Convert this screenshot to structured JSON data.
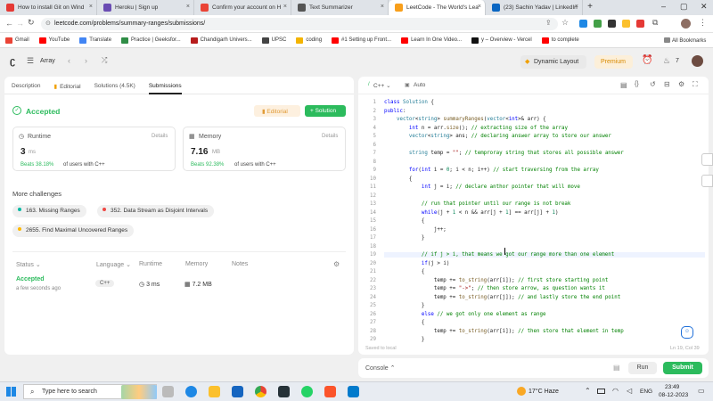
{
  "browser_tabs": [
    {
      "title": "How to install Git on Wind",
      "fav": "#e53935"
    },
    {
      "title": "Heroku | Sign up",
      "fav": "#6a4cb3"
    },
    {
      "title": "Confirm your account on H",
      "fav": "#ea4335"
    },
    {
      "title": "Text Summarizer",
      "fav": "#555555"
    },
    {
      "title": "LeetCode - The World's Lea",
      "fav": "#f89f1b"
    },
    {
      "title": "(23) Sachin Yadav | LinkedIn",
      "fav": "#0a66c2"
    }
  ],
  "address": {
    "url": "leetcode.com/problems/summary-ranges/submissions/"
  },
  "bookmarks": [
    {
      "label": "Gmail",
      "color": "#ea4335"
    },
    {
      "label": "YouTube",
      "color": "#ff0000"
    },
    {
      "label": "Translate",
      "color": "#4285f4"
    },
    {
      "label": "Practice | Geeksfor...",
      "color": "#2f8d46"
    },
    {
      "label": "Chandigarh Univers...",
      "color": "#b71c1c"
    },
    {
      "label": "UPSC",
      "color": "#444444"
    },
    {
      "label": "coding",
      "color": "#f4b400"
    },
    {
      "label": "#1 Setting up Front...",
      "color": "#ff0000"
    },
    {
      "label": "Learn In One Video...",
      "color": "#ff0000"
    },
    {
      "label": "y – Overview - Vercel",
      "color": "#111111"
    },
    {
      "label": "to complete",
      "color": "#ff0000"
    }
  ],
  "all_bookmarks": "All Bookmarks",
  "lc": {
    "problem_list": "Array",
    "layout": "Dynamic Layout",
    "premium": "Premium",
    "streak": "7"
  },
  "left_tabs": [
    "Description",
    "Editorial",
    "Solutions (4.5K)",
    "Submissions"
  ],
  "result": {
    "status": "Accepted",
    "editorial_btn": "Editorial",
    "solution_btn": "+ Solution",
    "runtime_label": "Runtime",
    "runtime_value": "3",
    "runtime_unit": "ms",
    "runtime_beats": "Beats 38.18%",
    "runtime_suffix": "of users with C++",
    "memory_label": "Memory",
    "memory_value": "7.16",
    "memory_unit": "MB",
    "memory_beats": "Beats 92.38%",
    "memory_suffix": "of users with C++",
    "details": "Details"
  },
  "more_challenges": {
    "heading": "More challenges",
    "items": [
      {
        "label": "163. Missing Ranges",
        "color": "#00b8a3"
      },
      {
        "label": "352. Data Stream as Disjoint Intervals",
        "color": "#ef4743"
      },
      {
        "label": "2655. Find Maximal Uncovered Ranges",
        "color": "#ffb800"
      }
    ]
  },
  "sub_table": {
    "headers": [
      "Status",
      "Language",
      "Runtime",
      "Memory",
      "Notes"
    ],
    "row": {
      "status": "Accepted",
      "time": "a few seconds ago",
      "lang": "C++",
      "runtime": "3 ms",
      "memory": "7.2 MB"
    }
  },
  "editor": {
    "lang": "C++",
    "auto": "Auto",
    "saved": "Saved to local",
    "cursor": "Ln 19, Col 39"
  },
  "code": [
    {
      "n": "1",
      "h": "<span class=\"kw\">class</span> <span class=\"ty\">Solution</span> {"
    },
    {
      "n": "2",
      "h": "<span class=\"kw\">public</span>:"
    },
    {
      "n": "3",
      "h": "    <span class=\"ty\">vector</span>&lt;<span class=\"ty\">string</span>&gt; <span class=\"fn\">summaryRanges</span>(<span class=\"ty\">vector</span>&lt;<span class=\"kw\">int</span>&gt;&amp; arr) {"
    },
    {
      "n": "4",
      "h": "        <span class=\"kw\">int</span> n = arr.<span class=\"fn\">size</span>(); <span class=\"cm\">// extracting size of the array</span>"
    },
    {
      "n": "5",
      "h": "        <span class=\"ty\">vector</span>&lt;<span class=\"ty\">string</span>&gt; ans; <span class=\"cm\">// declaring answer array to store our answer</span>"
    },
    {
      "n": "6",
      "h": ""
    },
    {
      "n": "7",
      "h": "        <span class=\"ty\">string</span> temp = <span class=\"st\">\"\"</span>; <span class=\"cm\">// temproray string that stores all possible answer</span>"
    },
    {
      "n": "8",
      "h": ""
    },
    {
      "n": "9",
      "h": "        <span class=\"kw\">for</span>(<span class=\"kw\">int</span> i = <span class=\"nm\">0</span>; i &lt; n; i++) <span class=\"cm\">// start traversing from the array</span>"
    },
    {
      "n": "10",
      "h": "        {"
    },
    {
      "n": "11",
      "h": "            <span class=\"kw\">int</span> j = i; <span class=\"cm\">// declare anthor pointer that will move</span>"
    },
    {
      "n": "12",
      "h": ""
    },
    {
      "n": "13",
      "h": "            <span class=\"cm\">// run that pointer until our range is not break</span>"
    },
    {
      "n": "14",
      "h": "            <span class=\"kw\">while</span>(j + <span class=\"nm\">1</span> &lt; n &amp;&amp; arr[j + <span class=\"nm\">1</span>] == arr[j] + <span class=\"nm\">1</span>)"
    },
    {
      "n": "15",
      "h": "            {"
    },
    {
      "n": "16",
      "h": "                j++;"
    },
    {
      "n": "17",
      "h": "            }"
    },
    {
      "n": "18",
      "h": ""
    },
    {
      "n": "19",
      "h": "            <span class=\"cm\">// if j &gt; i, that means we got our range more than one element</span>"
    },
    {
      "n": "20",
      "h": "            <span class=\"kw\">if</span>(j &gt; i)"
    },
    {
      "n": "21",
      "h": "            {"
    },
    {
      "n": "22",
      "h": "                temp += <span class=\"fn\">to_string</span>(arr[i]); <span class=\"cm\">// first store starting point</span>"
    },
    {
      "n": "23",
      "h": "                temp += <span class=\"st\">\"-&gt;\"</span>; <span class=\"cm\">// then store arrow, as question wants it</span>"
    },
    {
      "n": "24",
      "h": "                temp += <span class=\"fn\">to_string</span>(arr[j]); <span class=\"cm\">// and lastly store the end point</span>"
    },
    {
      "n": "25",
      "h": "            }"
    },
    {
      "n": "26",
      "h": "            <span class=\"kw\">else</span> <span class=\"cm\">// we got only one element as range</span>"
    },
    {
      "n": "27",
      "h": "            {"
    },
    {
      "n": "28",
      "h": "                temp += <span class=\"fn\">to_string</span>(arr[i]); <span class=\"cm\">// then store that element in temp</span>"
    },
    {
      "n": "29",
      "h": "            }"
    }
  ],
  "console": {
    "label": "Console",
    "run": "Run",
    "submit": "Submit"
  },
  "taskbar": {
    "search": "Type here to search",
    "weather": "17°C  Haze",
    "lang": "ENG",
    "time": "23:49",
    "date": "08-12-2023"
  }
}
